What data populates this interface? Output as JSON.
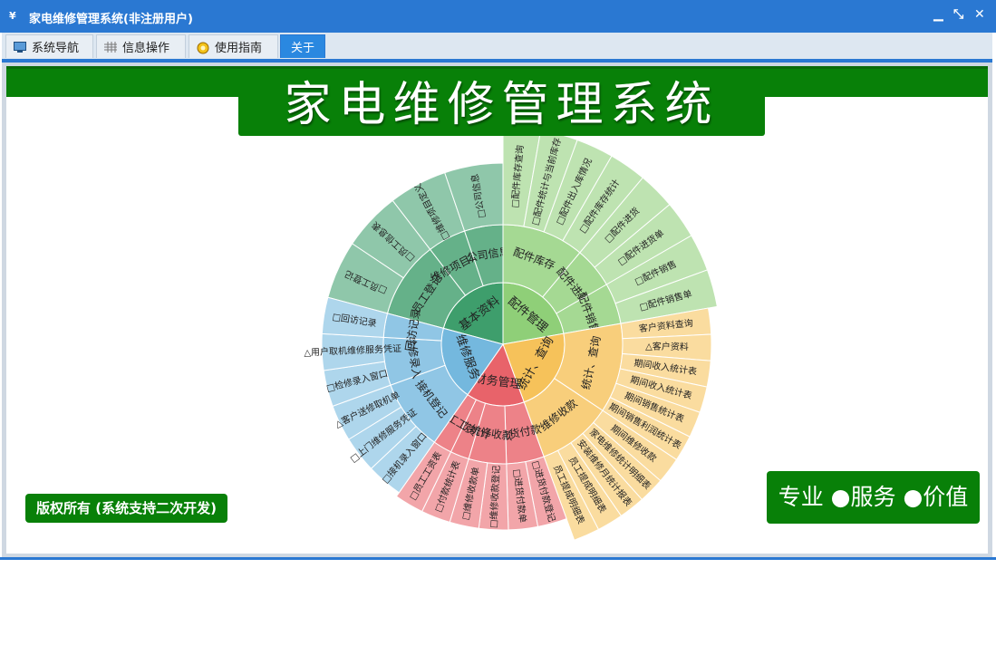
{
  "window": {
    "icon_text": "¥",
    "title": "家电维修管理系统(非注册用户)",
    "controls": {
      "minimize": "▁",
      "restore": "⤡",
      "close": "✕"
    }
  },
  "tabs": [
    {
      "label": "系统导航",
      "icon": "monitor-icon"
    },
    {
      "label": "信息操作",
      "icon": "grid-icon"
    },
    {
      "label": "使用指南",
      "icon": "help-icon"
    },
    {
      "label": "关于",
      "icon": "",
      "active": true
    }
  ],
  "main": {
    "title": "家电维修管理系统",
    "copyright": "版权所有 (系统支持二次开发)",
    "slogan": "专业 ●服务 ●价值"
  },
  "colors": {
    "titlebar": "#2a78d2",
    "brand_green": "#088008",
    "group_green": "#3e9e6c",
    "group_lightgreen": "#8fcf78",
    "group_orange": "#f6c25a",
    "group_red": "#e8636a",
    "group_blue": "#74b8de"
  },
  "sunburst": {
    "groups": [
      {
        "label": "基本资料",
        "color": "#3e9e6c",
        "children": [
          {
            "label": "员工登记",
            "leaves": [
              "□员工登记",
              "□员工信息表"
            ]
          },
          {
            "label": "维修项目定义",
            "leaves": [
              "□维修项目定义"
            ]
          },
          {
            "label": "公司信息",
            "leaves": [
              "□公司信息"
            ]
          }
        ]
      },
      {
        "label": "配件管理",
        "color": "#8fcf78",
        "children": [
          {
            "label": "配件库存",
            "leaves": [
              "□配件库存查询",
              "□配件统计与当前库存",
              "□配件出入库情况",
              "□配件库存统计"
            ]
          },
          {
            "label": "配件进货",
            "leaves": [
              "□配件进货",
              "□配件进货单"
            ]
          },
          {
            "label": "配件销售",
            "leaves": [
              "□配件销售",
              "□配件销售单"
            ]
          }
        ]
      },
      {
        "label": "统计、查询",
        "color": "#f6c25a",
        "children": [
          {
            "label": "统计、查询",
            "leaves": [
              "客户资料查询",
              "△客户资料",
              "期间收入统计表",
              "期间收入统计表",
              "期间销售统计表",
              "期间销售利润统计表"
            ]
          },
          {
            "label": "维修收款",
            "leaves": [
              "期间维修收款",
              "家电维修统计明细表",
              "安装维修月统计报表",
              "员工提成明细表",
              "员工提成明细表"
            ]
          }
        ]
      },
      {
        "label": "财务管理",
        "color": "#e8636a",
        "children": [
          {
            "label": "进货付款",
            "leaves": [
              "□进货付款登记",
              "□进货付款单"
            ]
          },
          {
            "label": "维修收款",
            "leaves": [
              "□维修收款登记",
              "□维修收款单"
            ]
          },
          {
            "label": "付款统计",
            "leaves": [
              "□付款统计表"
            ]
          },
          {
            "label": "员工工资",
            "leaves": [
              "□员工工资表"
            ]
          }
        ]
      },
      {
        "label": "维修服务",
        "color": "#74b8de",
        "children": [
          {
            "label": "接机登记",
            "leaves": [
              "□接机录入窗口",
              "□上门维修服务凭证",
              "△客户送修取机单"
            ]
          },
          {
            "label": "检修录入",
            "leaves": [
              "□检修录入窗口",
              "△用户取机维修服务凭证"
            ]
          },
          {
            "label": "回访记录",
            "leaves": [
              "□回访记录"
            ]
          }
        ]
      }
    ]
  }
}
